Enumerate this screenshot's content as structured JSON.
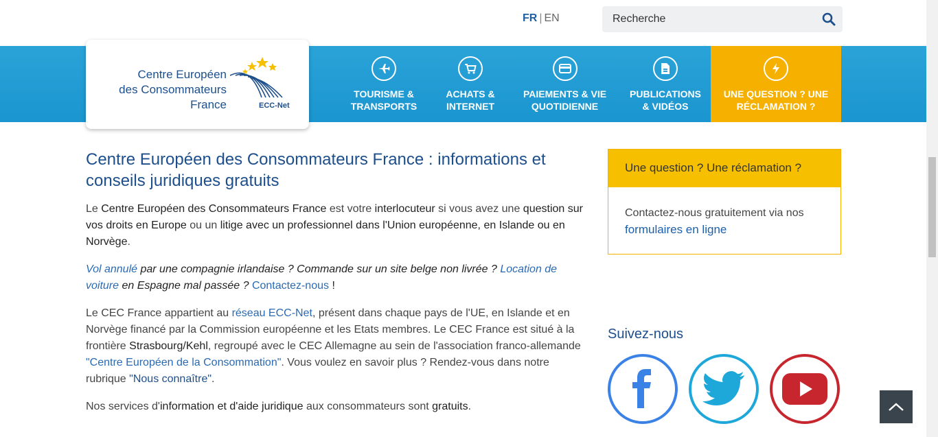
{
  "lang": {
    "fr": "FR",
    "sep": "|",
    "en": "EN"
  },
  "search": {
    "placeholder": "Recherche"
  },
  "logo": {
    "line1": "Centre Européen",
    "line2": "des Consommateurs",
    "line3": "France",
    "network": "ECC-Net"
  },
  "nav": [
    {
      "line1": "TOURISME &",
      "line2": "TRANSPORTS",
      "icon": "plane-icon"
    },
    {
      "line1": "ACHATS &",
      "line2": "INTERNET",
      "icon": "cart-icon"
    },
    {
      "line1": "PAIEMENTS & VIE",
      "line2": "QUOTIDIENNE",
      "icon": "card-icon"
    },
    {
      "line1": "PUBLICATIONS",
      "line2": "& VIDÉOS",
      "icon": "document-icon"
    },
    {
      "line1": "UNE QUESTION ? UNE",
      "line2": "RÉCLAMATION ?",
      "icon": "lightning-icon"
    }
  ],
  "main": {
    "title": "Centre Européen des Consommateurs France : informations et conseils juridiques gratuits",
    "p1": {
      "a": "Le ",
      "b": "Centre Européen des Consommateurs France",
      "c": " est votre ",
      "d": "interlocuteur",
      "e": " si vous avez une ",
      "f": "question sur vos droits en Europe",
      "g": " ou un ",
      "h": "litige avec un professionnel dans l'Union européenne, en Islande ou en Norvège",
      "i": "."
    },
    "p2": {
      "link1": "Vol annulé",
      "t1": " par une compagnie irlandaise ? Commande sur un site belge non livrée ?  ",
      "link2": "Location de voiture",
      "t2": " en Espagne mal passée ? ",
      "link3": "Contactez-nous",
      "t3": " !"
    },
    "p3": {
      "t1": "Le CEC France appartient au ",
      "link1": "réseau ECC-Net",
      "t2": ", présent dans chaque pays de l'UE, en Islande et en Norvège financé par la Commission européenne et les Etats membres.  Le CEC France est situé à la frontière ",
      "b1": "Strasbourg/Kehl",
      "t3": ", regroupé avec le CEC Allemagne au sein de l'association franco-allemande ",
      "link2": "\"Centre Européen de la Consommation\"",
      "t4": ". Vous voulez en savoir plus ? Rendez-vous dans notre rubrique ",
      "link3": "\"Nous connaître\"",
      "t5": "."
    },
    "p4": {
      "t1": "Nos services d'",
      "b1": "information et d'aide juridique",
      "t2": " aux consommateurs sont ",
      "b2": "gratuits",
      "t3": "."
    }
  },
  "side": {
    "head": "Une question ? Une réclamation ?",
    "body": "Contactez-nous gratuitement via nos",
    "link": "formulaires en ligne",
    "follow": "Suivez-nous"
  },
  "colors": {
    "accent": "#f6b000",
    "blue": "#1d4f8c",
    "band": "#1b95cf",
    "facebook": "#3b82e6",
    "twitter": "#1ea7d9",
    "youtube": "#c7262e"
  }
}
